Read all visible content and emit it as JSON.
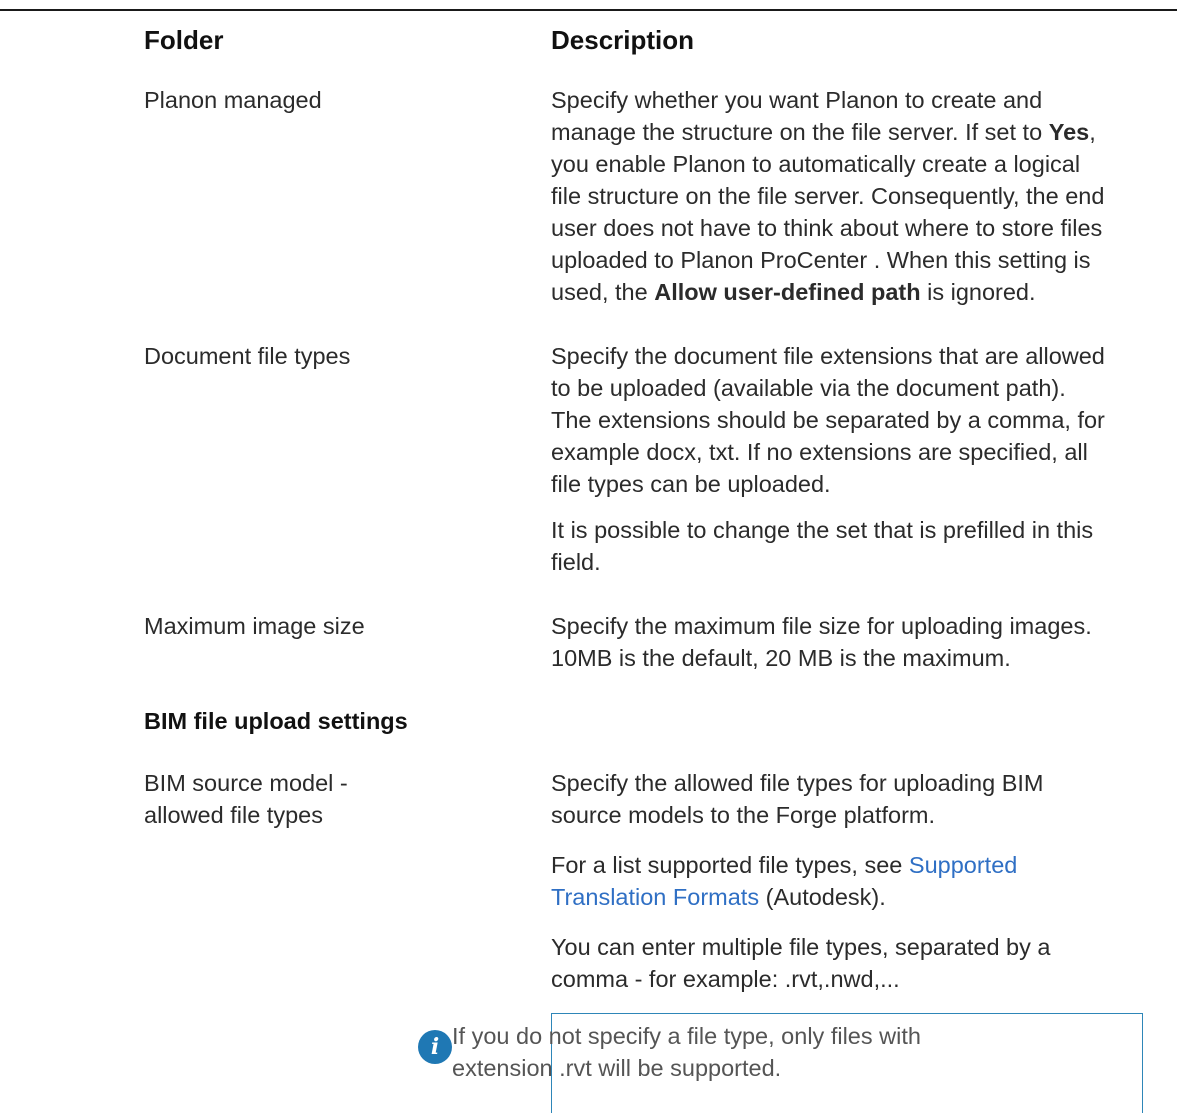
{
  "table": {
    "headers": {
      "folder": "Folder",
      "description": "Description"
    },
    "rows": {
      "planon_managed": {
        "name": "Planon managed",
        "desc_lines": [
          "Specify whether you want Planon to create and",
          [
            "manage the structure on the file server. If set to ",
            "Yes",
            ","
          ],
          "you enable Planon to automatically create a logical",
          "file structure on the file server. Consequently, the end",
          "user does not have to think about where to store files",
          "uploaded to Planon ProCenter . When this setting is",
          [
            "used, the ",
            "Allow user-defined path",
            " is ignored."
          ]
        ]
      },
      "document_file_types": {
        "name": "Document file types",
        "para1_lines": [
          "Specify the document file extensions that are allowed",
          "to be uploaded (available via the document path).",
          "The extensions should be separated by a comma, for",
          "example docx, txt. If no extensions are specified, all",
          "file types can be uploaded."
        ],
        "para2_lines": [
          "It is possible to change the set that is prefilled in this",
          "field."
        ]
      },
      "maximum_image_size": {
        "name": "Maximum image size",
        "desc_lines": [
          "Specify the maximum file size for uploading images.",
          "10MB is the default, 20 MB is the maximum."
        ]
      }
    },
    "section_heading": "BIM file upload settings",
    "bim_row": {
      "name_lines": [
        "BIM source model -",
        "allowed file types"
      ],
      "para1_lines": [
        "Specify the allowed file types for uploading BIM",
        "source models to the Forge platform."
      ],
      "para2_prefix": "For a list supported file types, see ",
      "para2_link_line1": "Supported",
      "para2_link_line2": "Translation Formats",
      "para2_suffix": " (Autodesk).",
      "para3_lines": [
        "You can enter multiple file types, separated by a",
        "comma - for example: .rvt,.nwd,..."
      ]
    },
    "note": {
      "icon": "info-icon",
      "lines": [
        "If you do not specify a file type, only files with",
        "extension .rvt will be supported."
      ]
    }
  }
}
